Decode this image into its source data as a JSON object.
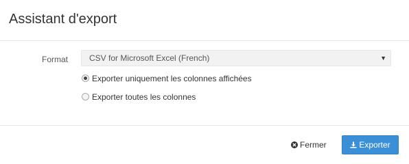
{
  "dialog": {
    "title": "Assistant d'export"
  },
  "form": {
    "format_label": "Format",
    "format_selected": "CSV for Microsoft Excel (French)",
    "options": [
      {
        "label": "Exporter uniquement les colonnes affichées",
        "checked": true
      },
      {
        "label": "Exporter toutes les colonnes",
        "checked": false
      }
    ]
  },
  "footer": {
    "close_label": "Fermer",
    "close_icon": "times-circle-icon",
    "export_label": "Exporter",
    "export_icon": "download-icon"
  },
  "colors": {
    "primary": "#3a8fd6",
    "border": "#e5e5e5",
    "select_bg": "#f2f2f2"
  }
}
